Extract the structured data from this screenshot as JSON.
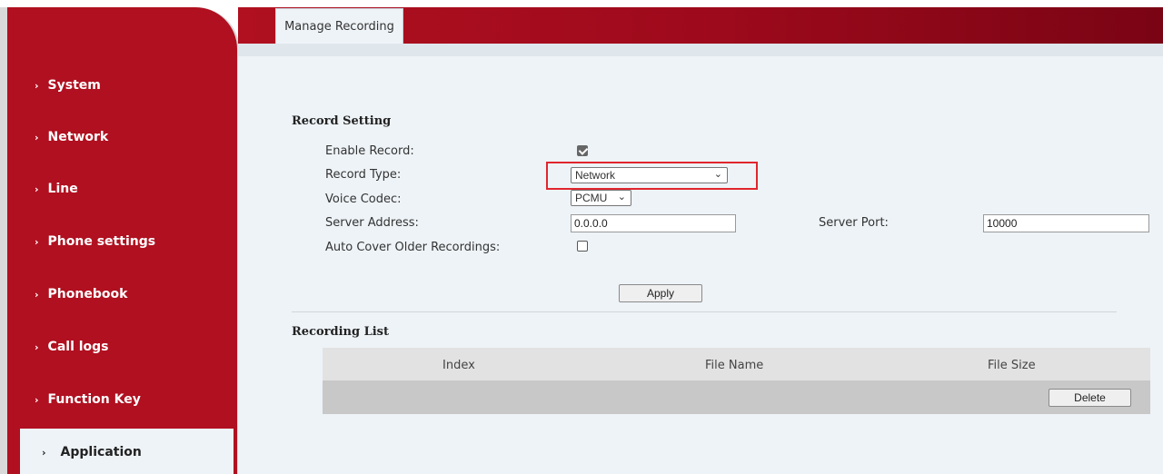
{
  "sidebar": {
    "items": [
      {
        "label": "System"
      },
      {
        "label": "Network"
      },
      {
        "label": "Line"
      },
      {
        "label": "Phone settings"
      },
      {
        "label": "Phonebook"
      },
      {
        "label": "Call logs"
      },
      {
        "label": "Function Key"
      },
      {
        "label": "Application",
        "active": true
      }
    ]
  },
  "tabs": [
    {
      "label": "Manage Recording"
    }
  ],
  "record_setting": {
    "title": "Record Setting",
    "enable_record_label": "Enable Record:",
    "enable_record_checked": true,
    "record_type_label": "Record Type:",
    "record_type_value": "Network",
    "voice_codec_label": "Voice Codec:",
    "voice_codec_value": "PCMU",
    "server_address_label": "Server Address:",
    "server_address_value": "0.0.0.0",
    "server_port_label": "Server Port:",
    "server_port_value": "10000",
    "auto_cover_label": "Auto Cover Older Recordings:",
    "auto_cover_checked": false,
    "apply_label": "Apply"
  },
  "recording_list": {
    "title": "Recording List",
    "columns": [
      "Index",
      "File Name",
      "File Size"
    ],
    "delete_label": "Delete"
  },
  "colors": {
    "brand_red": "#b01020",
    "panel_bg": "#eef3f7",
    "highlight_red": "#e0262e"
  },
  "icons": {
    "nav_chevron": "chevron-right-icon",
    "select_arrow": "chevron-down-icon",
    "checkbox_checked": "checkmark-icon"
  }
}
